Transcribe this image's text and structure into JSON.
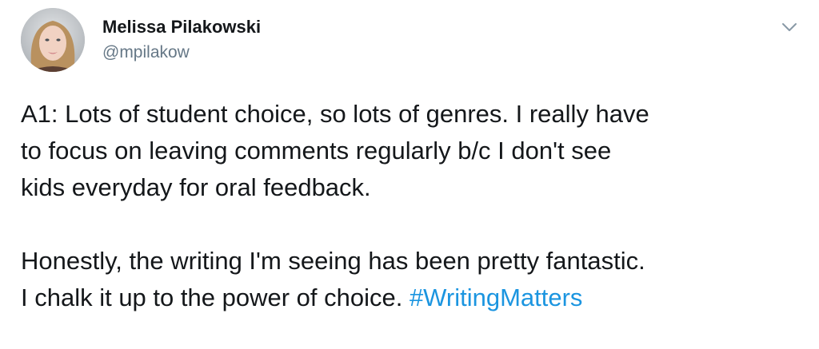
{
  "author": {
    "display_name": "Melissa Pilakowski",
    "handle": "@mpilakow"
  },
  "tweet": {
    "paragraph1_lines": [
      "A1: Lots of student choice, so lots of genres. I really have",
      "to focus on leaving comments regularly b/c I don't see",
      "kids everyday for oral feedback."
    ],
    "paragraph2_lines": [
      "Honestly, the writing I'm seeing has been pretty fantastic.",
      "I chalk it up to the power of choice. "
    ],
    "hashtag": "#WritingMatters"
  },
  "colors": {
    "text": "#14171a",
    "secondary": "#657786",
    "link": "#1b95e0"
  },
  "icons": {
    "menu": "chevron-down-icon"
  }
}
